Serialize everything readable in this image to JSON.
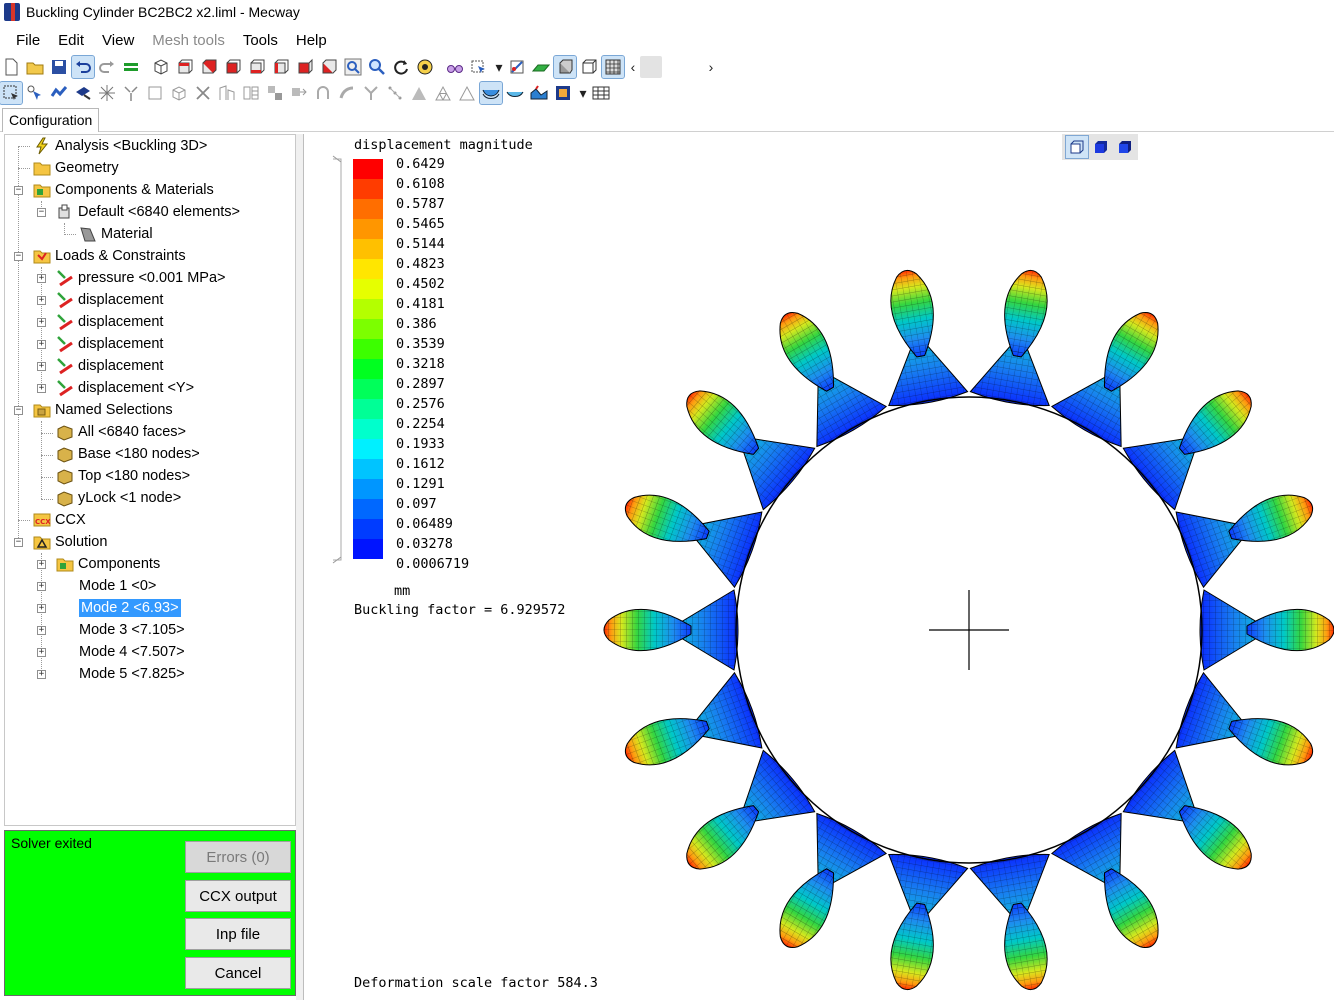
{
  "window": {
    "title": "Buckling Cylinder BC2BC2 x2.liml - Mecway"
  },
  "menu": [
    {
      "label": "File",
      "disabled": false
    },
    {
      "label": "Edit",
      "disabled": false
    },
    {
      "label": "View",
      "disabled": false
    },
    {
      "label": "Mesh tools",
      "disabled": true
    },
    {
      "label": "Tools",
      "disabled": false
    },
    {
      "label": "Help",
      "disabled": false
    }
  ],
  "tabs": {
    "configuration": "Configuration"
  },
  "tree": {
    "analysis": "Analysis <Buckling 3D>",
    "geometry": "Geometry",
    "components": "Components & Materials",
    "default": "Default <6840 elements>",
    "material": "Material",
    "loads": "Loads & Constraints",
    "pressure": "pressure <0.001 MPa>",
    "displacement1": "displacement",
    "displacement2": "displacement",
    "displacement3": "displacement",
    "displacement4": "displacement",
    "displacement5": "displacement <Y>",
    "named_selections": "Named Selections",
    "all": "All <6840 faces>",
    "base": "Base <180 nodes>",
    "top": "Top <180 nodes>",
    "ylock": "yLock <1 node>",
    "ccx": "CCX",
    "solution": "Solution",
    "sol_components": "Components",
    "mode1": "Mode 1 <0>",
    "mode2": "Mode 2 <6.93>",
    "mode3": "Mode 3 <7.105>",
    "mode4": "Mode 4 <7.507>",
    "mode5": "Mode 5 <7.825>"
  },
  "status": {
    "text": "Solver exited",
    "errors_button": "Errors (0)",
    "ccx_output_button": "CCX output",
    "inp_file_button": "Inp file",
    "cancel_button": "Cancel",
    "panel_color": "#00ff00"
  },
  "viewport": {
    "legend_title": "displacement magnitude",
    "legend_values": [
      "0.6429",
      "0.6108",
      "0.5787",
      "0.5465",
      "0.5144",
      "0.4823",
      "0.4502",
      "0.4181",
      "0.386",
      "0.3539",
      "0.3218",
      "0.2897",
      "0.2576",
      "0.2254",
      "0.1933",
      "0.1612",
      "0.1291",
      "0.097",
      "0.06489",
      "0.03278",
      "0.0006719"
    ],
    "units": "mm",
    "buckling_factor": "Buckling factor = 6.929572",
    "deformation_scale": "Deformation scale factor 584.3",
    "lobe_count": 18
  }
}
